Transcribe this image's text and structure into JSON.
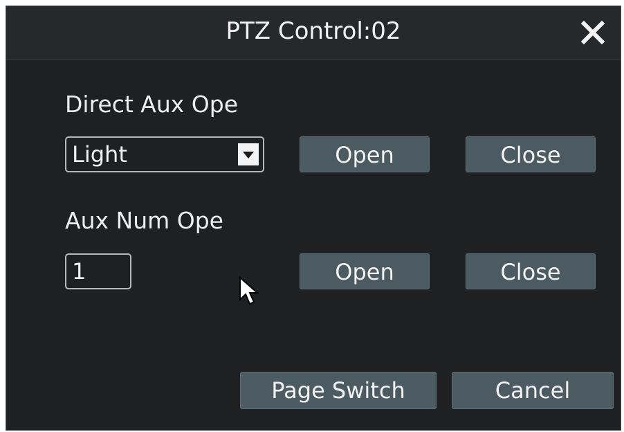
{
  "dialog": {
    "title": "PTZ Control:02",
    "close_icon": "close-icon"
  },
  "direct_aux": {
    "label": "Direct Aux Ope",
    "dropdown_value": "Light",
    "open_label": "Open",
    "close_label": "Close"
  },
  "aux_num": {
    "label": "Aux Num Ope",
    "input_value": "1",
    "open_label": "Open",
    "close_label": "Close"
  },
  "footer": {
    "page_switch_label": "Page Switch",
    "cancel_label": "Cancel"
  },
  "colors": {
    "background": "#1e2022",
    "titlebar": "#25292c",
    "button": "#4b5b61",
    "text": "#f2f2f2"
  }
}
